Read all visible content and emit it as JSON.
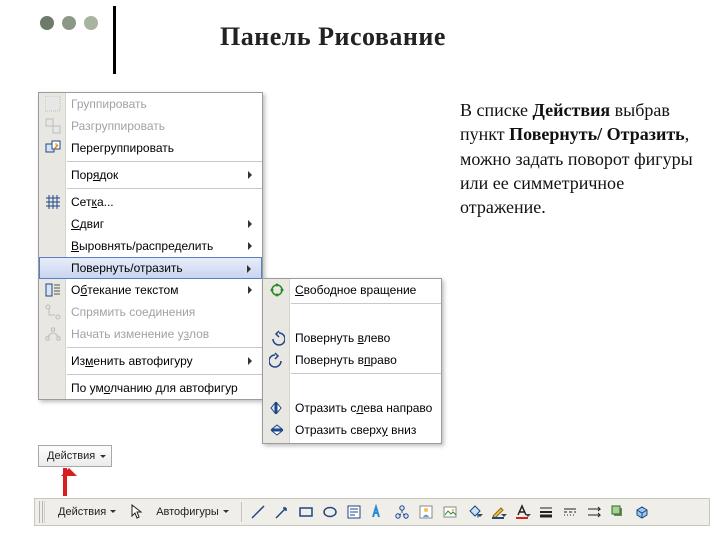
{
  "slide": {
    "title": "Панель Рисование",
    "desc_parts": {
      "p1": "В списке ",
      "b1": "Действия",
      "p2": " выбрав пункт ",
      "b2": "Повернуть/ Отразить",
      "p3": ", можно задать поворот фигуры или ее симметричное отражение."
    }
  },
  "menu": {
    "items": [
      {
        "icon": "group",
        "label": "Группировать",
        "disabled": true
      },
      {
        "icon": "ungroup",
        "label": "Разгруппировать",
        "disabled": true
      },
      {
        "icon": "regroup",
        "label": "Перегруппировать"
      },
      {
        "sep": true
      },
      {
        "label": "Порядок",
        "sub": true,
        "ul": [
          3
        ]
      },
      {
        "sep": true
      },
      {
        "icon": "grid",
        "label": "Сетка...",
        "ul": [
          3
        ]
      },
      {
        "label": "Сдвиг",
        "sub": true,
        "ul": [
          0
        ]
      },
      {
        "label": "Выровнять/распределить",
        "sub": true,
        "ul": [
          0
        ]
      },
      {
        "label": "Повернуть/отразить",
        "sub": true,
        "highlight": true
      },
      {
        "icon": "wrap",
        "label": "Обтекание текстом",
        "sub": true,
        "ul": [
          1
        ]
      },
      {
        "icon": "route",
        "label": "Спрямить соединения",
        "disabled": true
      },
      {
        "icon": "nodes",
        "label": "Начать изменение узлов",
        "disabled": true,
        "ul": [
          18
        ]
      },
      {
        "sep": true
      },
      {
        "label": "Изменить автофигуру",
        "sub": true,
        "ul": [
          2
        ]
      },
      {
        "sep": true
      },
      {
        "label": "По умолчанию для автофигур",
        "ul": [
          5
        ]
      }
    ]
  },
  "submenu": {
    "items": [
      {
        "icon": "free-rotate",
        "label": "Свободное вращение",
        "ul": [
          0
        ]
      },
      {
        "sep": true
      },
      {
        "icon": "rot-left",
        "label": "Повернуть влево",
        "ul": [
          10
        ]
      },
      {
        "icon": "rot-right",
        "label": "Повернуть вправо",
        "ul": [
          11
        ]
      },
      {
        "sep": true
      },
      {
        "icon": "flip-h",
        "label": "Отразить слева направо",
        "ul": [
          10
        ]
      },
      {
        "icon": "flip-v",
        "label": "Отразить сверху вниз",
        "ul": [
          14
        ]
      }
    ]
  },
  "actions_button_label": "Действия",
  "toolbar": {
    "actions": "Действия",
    "autoshapes": "Автофигуры",
    "icons": [
      "pointer",
      "line",
      "arrow",
      "rect",
      "oval",
      "textbox",
      "wordart",
      "diagram",
      "clipart",
      "picture",
      "fill",
      "linecolor",
      "fontcolor",
      "lineweight",
      "linestyle",
      "arrowstyle",
      "shadow",
      "3d"
    ]
  }
}
